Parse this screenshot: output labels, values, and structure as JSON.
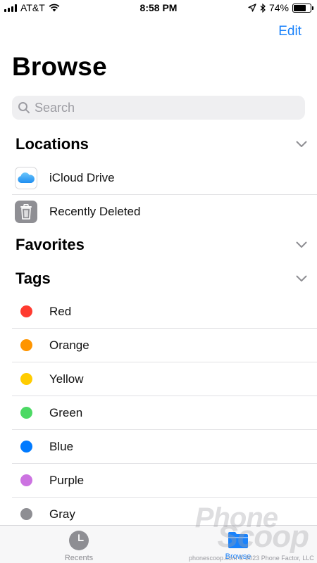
{
  "status_bar": {
    "carrier": "AT&T",
    "time": "8:58 PM",
    "battery_percent": "74%",
    "battery_level": 0.74,
    "signal_icon": "signal-bars-icon",
    "wifi_icon": "wifi-icon",
    "location_icon": "location-arrow-icon",
    "bluetooth_icon": "bluetooth-icon"
  },
  "header": {
    "edit_label": "Edit",
    "title": "Browse"
  },
  "search": {
    "placeholder": "Search"
  },
  "sections": {
    "locations": {
      "title": "Locations",
      "items": [
        {
          "label": "iCloud Drive",
          "icon": "icloud-icon"
        },
        {
          "label": "Recently Deleted",
          "icon": "trash-icon"
        }
      ]
    },
    "favorites": {
      "title": "Favorites"
    },
    "tags": {
      "title": "Tags",
      "items": [
        {
          "label": "Red",
          "color": "#ff3b30"
        },
        {
          "label": "Orange",
          "color": "#ff9500"
        },
        {
          "label": "Yellow",
          "color": "#ffcc00"
        },
        {
          "label": "Green",
          "color": "#4cd964"
        },
        {
          "label": "Blue",
          "color": "#007aff"
        },
        {
          "label": "Purple",
          "color": "#cc73e1"
        },
        {
          "label": "Gray",
          "color": "#8e8e93"
        }
      ]
    }
  },
  "tab_bar": {
    "tabs": [
      {
        "label": "Recents",
        "icon": "clock-icon",
        "selected": false
      },
      {
        "label": "Browse",
        "icon": "folder-icon",
        "selected": true
      }
    ]
  },
  "watermark": {
    "line1": "Phone",
    "line2": "Scoop",
    "copyright": "phonescoop.com © 2023 Phone Factor, LLC"
  },
  "colors": {
    "accent": "#1a82fb",
    "separator": "#e1e1e4"
  }
}
